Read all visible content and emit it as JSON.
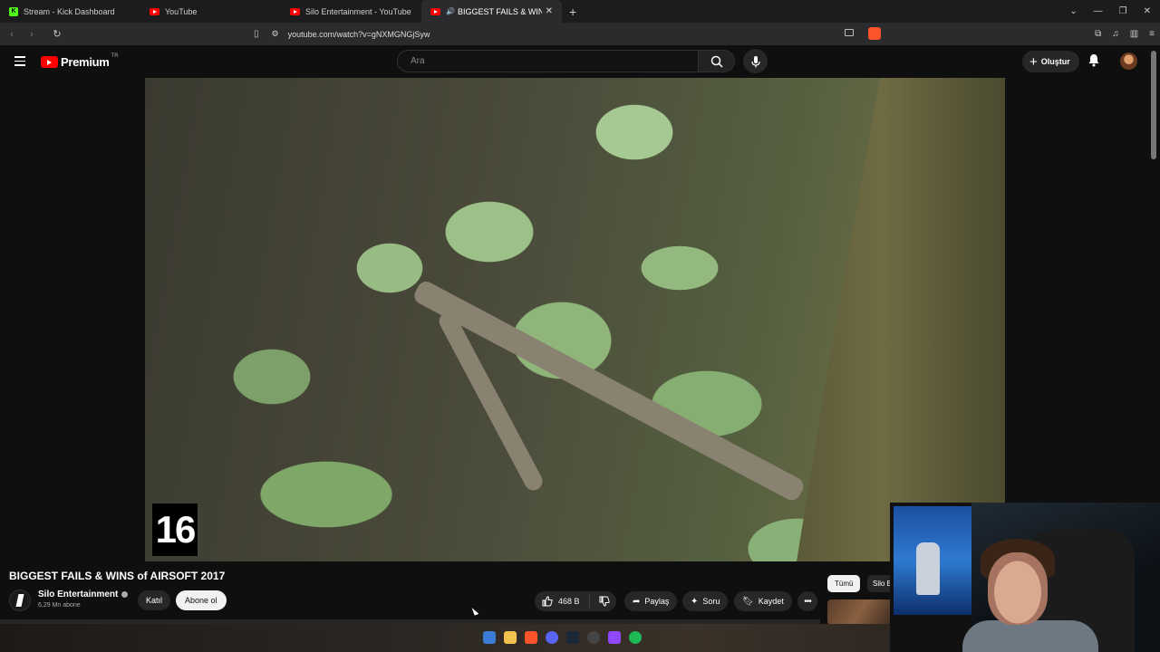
{
  "browser": {
    "tabs": [
      {
        "label": "Stream - Kick Dashboard",
        "favicon": "kick-icon",
        "active": false
      },
      {
        "label": "YouTube",
        "favicon": "youtube-icon",
        "active": false
      },
      {
        "label": "Silo Entertainment - YouTube",
        "favicon": "youtube-icon",
        "active": false
      },
      {
        "label": "BIGGEST FAILS & WINS of AI",
        "favicon": "youtube-icon",
        "active": true
      }
    ],
    "url": "youtube.com/watch?v=gNXMGNGjSyw"
  },
  "youtube": {
    "logo_text": "Premium",
    "logo_country": "TR",
    "search_placeholder": "Ara",
    "create_label": "Oluştur"
  },
  "video": {
    "overlay_number": "16",
    "title": "BIGGEST FAILS & WINS of AIRSOFT 2017",
    "channel_name": "Silo Entertainment",
    "subscribers": "6,29 Mn abone",
    "join_label": "Katıl",
    "subscribe_label": "Abone ol",
    "likes": "468 B",
    "share_label": "Paylaş",
    "ask_label": "Soru",
    "save_label": "Kaydet"
  },
  "sidebar": {
    "chip_all": "Tümü",
    "chip_channel": "Silo E"
  },
  "colors": {
    "background": "#0f0f0f",
    "brand_red": "#ff0000",
    "button_bg": "#272727"
  }
}
